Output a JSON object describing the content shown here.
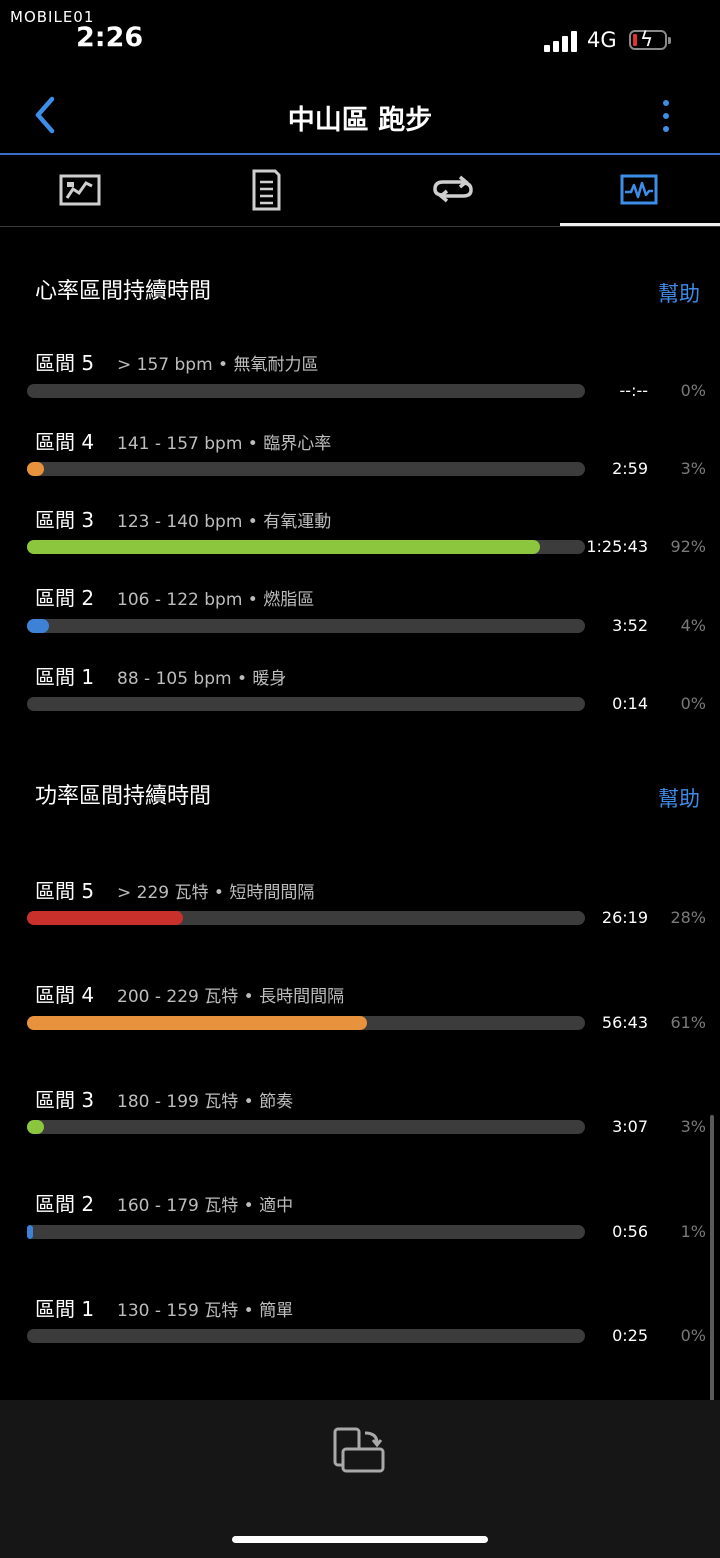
{
  "status_bar": {
    "watermark": "MOBILE01",
    "time": "2:26",
    "network": "4G"
  },
  "header": {
    "title": "中山區 跑步"
  },
  "tabs": [
    {
      "icon": "map-icon"
    },
    {
      "icon": "details-icon"
    },
    {
      "icon": "laps-icon"
    },
    {
      "icon": "charts-icon",
      "selected": true
    }
  ],
  "heart_rate": {
    "title": "心率區間持續時間",
    "help": "幫助",
    "zones": [
      {
        "name": "區間 5",
        "desc": "> 157 bpm • 無氧耐力區",
        "time": "--:--",
        "percent": "0%",
        "fraction": 0,
        "color": "#e8923e"
      },
      {
        "name": "區間 4",
        "desc": "141 - 157 bpm • 臨界心率",
        "time": "2:59",
        "percent": "3%",
        "fraction": 0.03,
        "color": "#e8923e"
      },
      {
        "name": "區間 3",
        "desc": "123 - 140 bpm • 有氧運動",
        "time": "1:25:43",
        "percent": "92%",
        "fraction": 0.92,
        "color": "#8cc63f"
      },
      {
        "name": "區間 2",
        "desc": "106 - 122 bpm • 燃脂區",
        "time": "3:52",
        "percent": "4%",
        "fraction": 0.04,
        "color": "#3e82d8"
      },
      {
        "name": "區間 1",
        "desc": "88 - 105 bpm • 暖身",
        "time": "0:14",
        "percent": "0%",
        "fraction": 0,
        "color": "#8a8a8a"
      }
    ]
  },
  "power": {
    "title": "功率區間持續時間",
    "help": "幫助",
    "zones": [
      {
        "name": "區間 5",
        "desc": "> 229 瓦特 • 短時間間隔",
        "time": "26:19",
        "percent": "28%",
        "fraction": 0.28,
        "color": "#c9302c"
      },
      {
        "name": "區間 4",
        "desc": "200 - 229 瓦特 • 長時間間隔",
        "time": "56:43",
        "percent": "61%",
        "fraction": 0.61,
        "color": "#e8923e"
      },
      {
        "name": "區間 3",
        "desc": "180 - 199 瓦特 • 節奏",
        "time": "3:07",
        "percent": "3%",
        "fraction": 0.03,
        "color": "#8cc63f"
      },
      {
        "name": "區間 2",
        "desc": "160 - 179 瓦特 • 適中",
        "time": "0:56",
        "percent": "1%",
        "fraction": 0.01,
        "color": "#3e82d8"
      },
      {
        "name": "區間 1",
        "desc": "130 - 159 瓦特 • 簡單",
        "time": "0:25",
        "percent": "0%",
        "fraction": 0,
        "color": "#8a8a8a"
      }
    ]
  },
  "bottom": {
    "icon": "rotate-screen-icon"
  }
}
